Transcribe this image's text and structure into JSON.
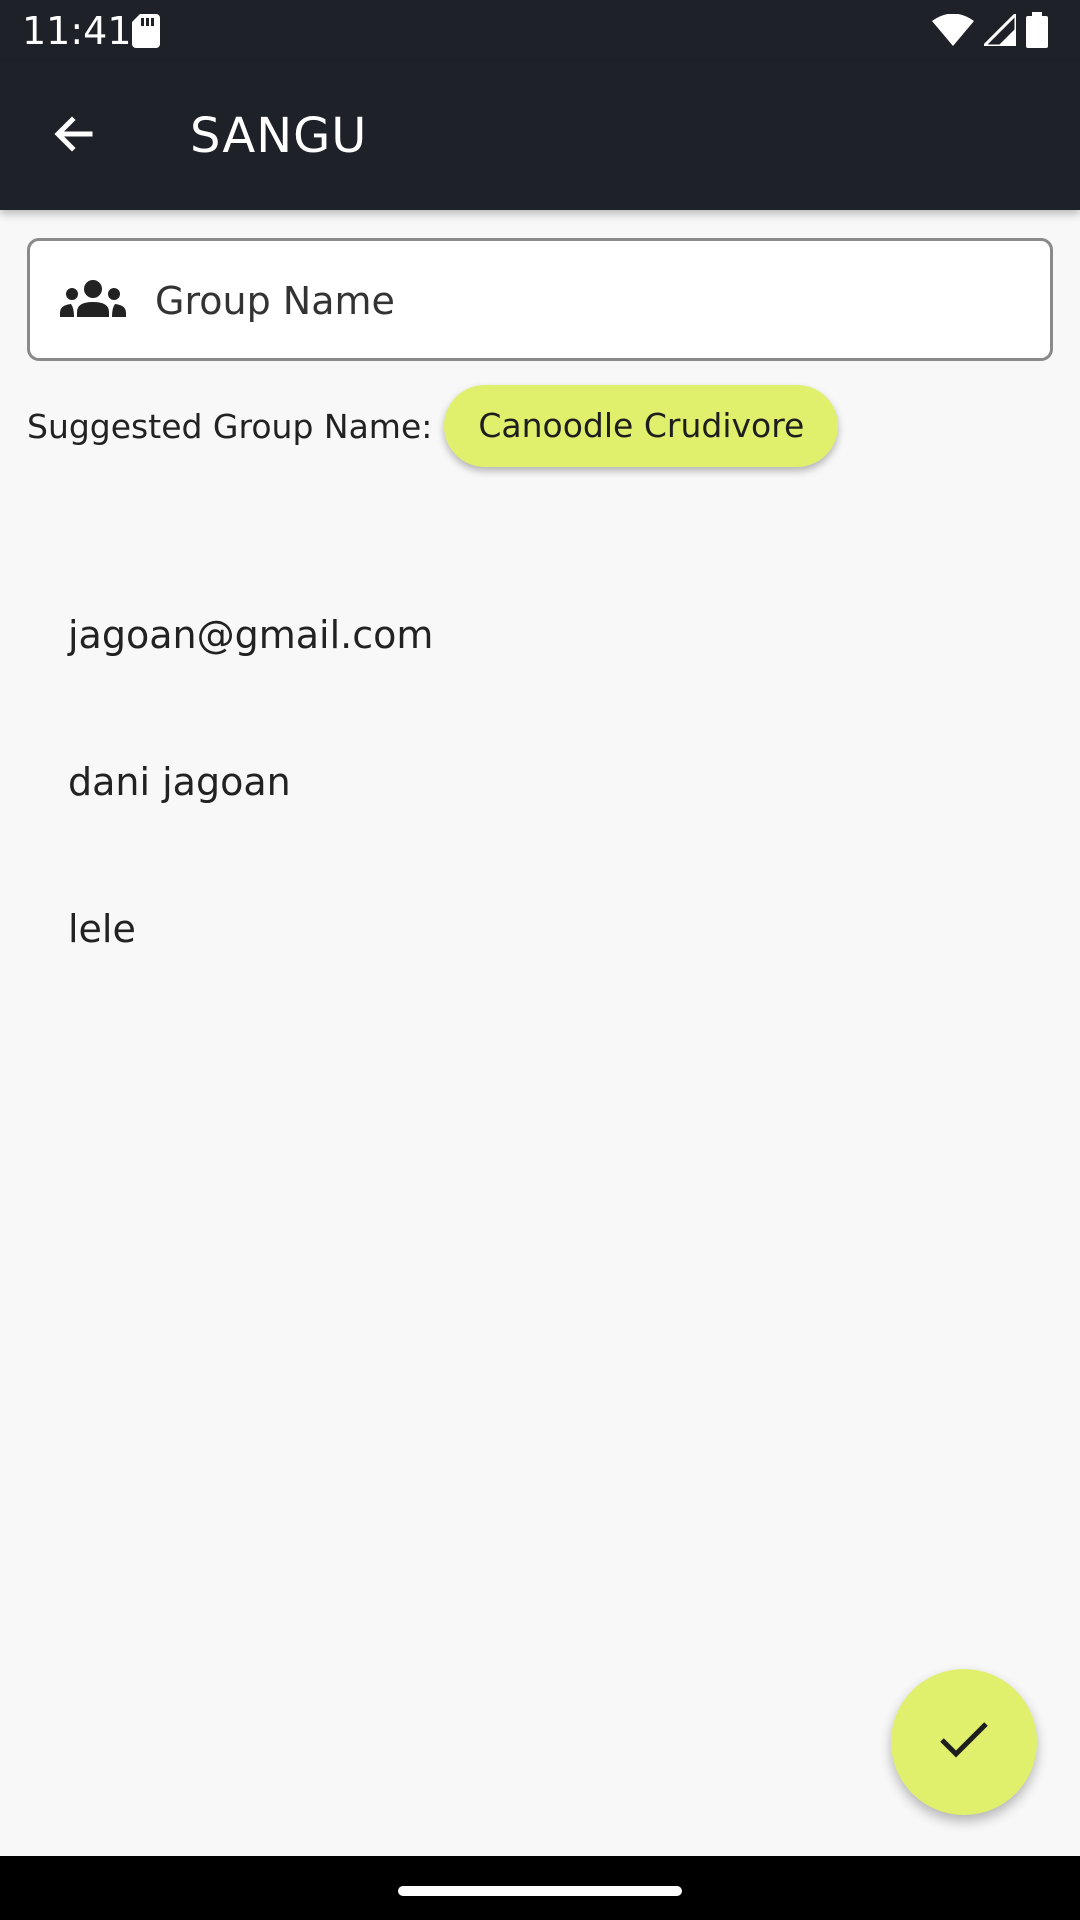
{
  "status_bar": {
    "time": "11:41",
    "icons": [
      "sd-card-icon",
      "wifi-icon",
      "signal-icon",
      "battery-icon"
    ]
  },
  "app_bar": {
    "title": "SANGU",
    "back_icon": "arrow-back-icon"
  },
  "group_name": {
    "icon": "group-icon",
    "placeholder": "Group Name",
    "value": ""
  },
  "suggestion": {
    "label": "Suggested Group Name:",
    "chip": "Canoodle Crudivore"
  },
  "members": [
    {
      "label": "jagoan@gmail.com"
    },
    {
      "label": "dani jagoan"
    },
    {
      "label": "lele"
    }
  ],
  "fab": {
    "icon": "check-icon"
  },
  "colors": {
    "bar_background": "#1f2128",
    "content_background": "#f8f8f8",
    "accent": "#e1f06c",
    "text": "#222222"
  }
}
